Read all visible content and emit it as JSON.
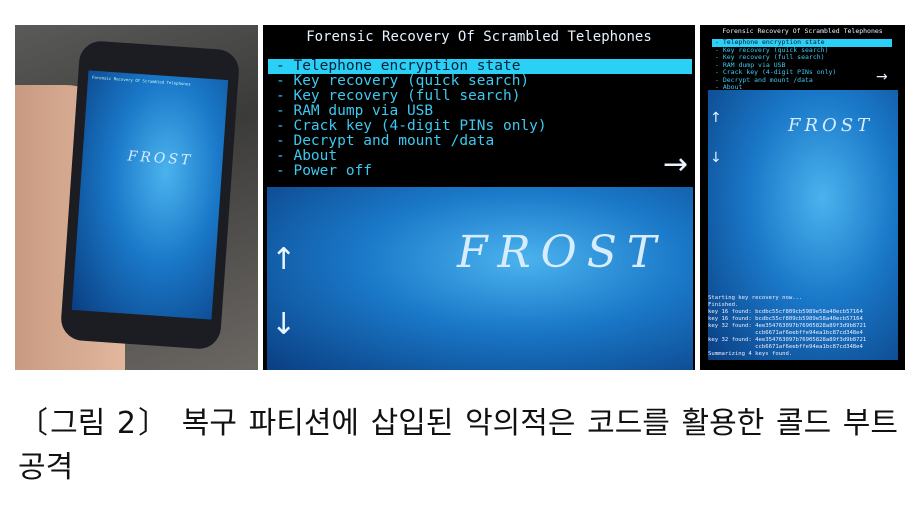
{
  "menu": {
    "title": "Forensic Recovery Of Scrambled Telephones",
    "items": [
      "- Telephone encryption state",
      "- Key recovery (quick search)",
      "- Key recovery (full search)",
      "- RAM dump via USB",
      "- Crack key (4-digit PINs only)",
      "- Decrypt and mount /data",
      "- About",
      "- Power off"
    ],
    "selected_index": 0,
    "logo": "FROST",
    "highlight_color": "#2ad0f5"
  },
  "log": [
    "Starting key recovery now...",
    "Finished.",
    "key 16 found: bcdbc55cf809cb5989e58a40ecb57164",
    "key 16 found: bcdbc55cf809cb5989e58a40ecb57164",
    "key 32 found: 4ee354763097b76905828a89f3d9b8721",
    "              ccb6671af6eebffe94ea1bc87cd348e4",
    "key 32 found: 4ee354763097b76905828a89f3d9b8721",
    "              ccb6671af6eebffe94ea1bc87cd348e4",
    "Summarizing 4 keys found."
  ],
  "caption": "〔그림 2〕 복구 파티션에 삽입된 악의적은 코드를 활용한 콜드 부트 공격"
}
